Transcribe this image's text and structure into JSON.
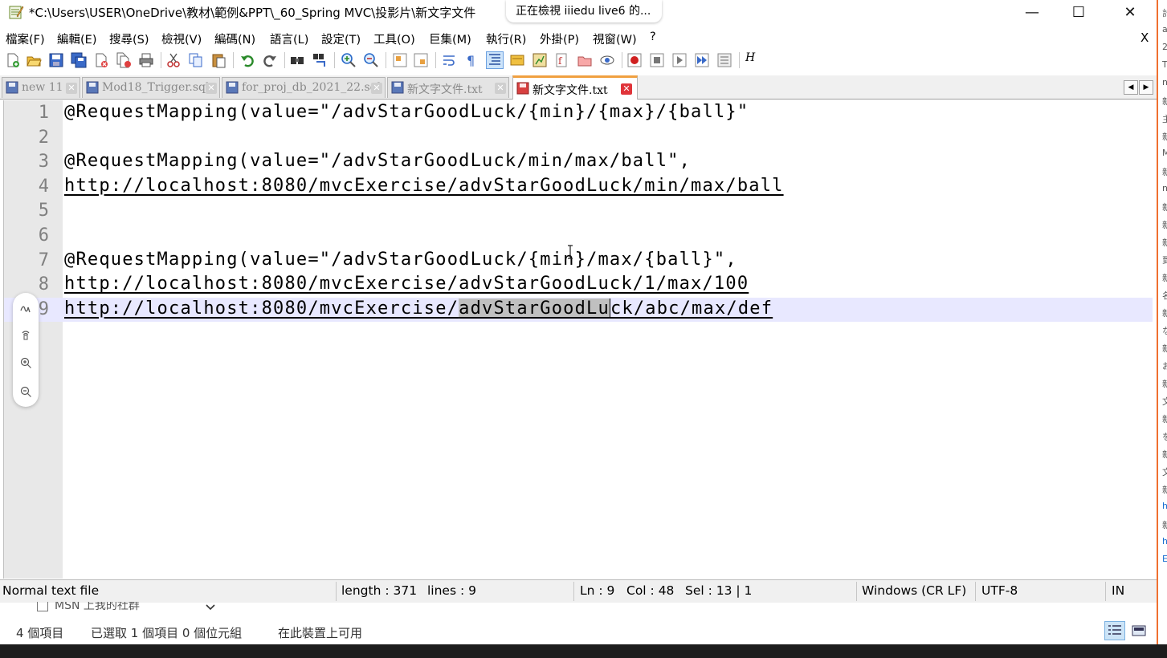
{
  "window": {
    "title": "*C:\\Users\\USER\\OneDrive\\教材\\範例&PPT\\_60_Spring MVC\\投影片\\新文字文件",
    "popup": "正在檢視 iiiedu live6 的...",
    "minimize_glyph": "—",
    "maximize_glyph": "☐",
    "close_glyph": "✕"
  },
  "menu": {
    "items": [
      "檔案(F)",
      "編輯(E)",
      "搜尋(S)",
      "檢視(V)",
      "編碼(N)",
      "語言(L)",
      "設定(T)",
      "工具(O)",
      "巨集(M)",
      "執行(R)",
      "外掛(P)",
      "視窗(W)",
      "?"
    ],
    "close_label": "X"
  },
  "toolbar": {
    "last_label": "H"
  },
  "tabs": [
    {
      "label": "new 11",
      "active": false
    },
    {
      "label": "Mod18_Trigger.sql",
      "active": false
    },
    {
      "label": "for_proj_db_2021_22.sql",
      "active": false
    },
    {
      "label": "新文字文件.txt",
      "active": false
    },
    {
      "label": "新文字文件.txt",
      "active": true
    }
  ],
  "tab_scroll": {
    "left": "◀",
    "right": "▶"
  },
  "editor": {
    "lines": [
      {
        "num": "1",
        "text": "@RequestMapping(value=\"/advStarGoodLuck/{min}/{max}/{ball}\""
      },
      {
        "num": "2",
        "text": ""
      },
      {
        "num": "3",
        "text": "@RequestMapping(value=\"/advStarGoodLuck/min/max/ball\","
      },
      {
        "num": "4",
        "text": "http://localhost:8080/mvcExercise/advStarGoodLuck/min/max/ball"
      },
      {
        "num": "5",
        "text": ""
      },
      {
        "num": "6",
        "text": ""
      },
      {
        "num": "7",
        "text": "@RequestMapping(value=\"/advStarGoodLuck/{min}/max/{ball}\","
      },
      {
        "num": "8",
        "text": "http://localhost:8080/mvcExercise/advStarGoodLuck/1/max/100"
      },
      {
        "num": "9",
        "text_before": "http://localhost:8080/mvcExercise/",
        "text_selected": "advStarGoodLu",
        "text_after": "ck/abc/max/def"
      }
    ],
    "current_line": 9,
    "selection": "advStarGoodLu"
  },
  "statusbar": {
    "file_type": "Normal text file",
    "length": "length : 371",
    "lines": "lines : 9",
    "ln": "Ln : 9",
    "col": "Col : 48",
    "sel": "Sel : 13 | 1",
    "eol": "Windows (CR LF)",
    "encoding": "UTF-8",
    "mode": "IN"
  },
  "explorer": {
    "partial_item": "MSN 上我的社群",
    "items_count": "4 個項目",
    "selected": "已選取 1 個項目  0 個位元組",
    "availability": "在此裝置上可用"
  },
  "right_strip": {
    "chars": [
      "計",
      "a",
      "2",
      "T",
      "n",
      "新",
      "主",
      "新",
      "M",
      "新",
      "n",
      "新",
      "新",
      "新",
      "到",
      "新",
      "名",
      "新",
      "な",
      "新",
      "お",
      "新",
      "文",
      "新",
      "を",
      "新",
      "文",
      "新",
      "h",
      "新",
      "h",
      "E"
    ]
  },
  "colors": {
    "current_line_bg": "#e8e8ff",
    "selection_bg": "#c0c0c0",
    "active_tab_accent": "#f0a040",
    "tab_close_active": "#e0343a",
    "gutter_bg": "#e8e8e8",
    "statusbar_bg": "#f0f0f0"
  }
}
